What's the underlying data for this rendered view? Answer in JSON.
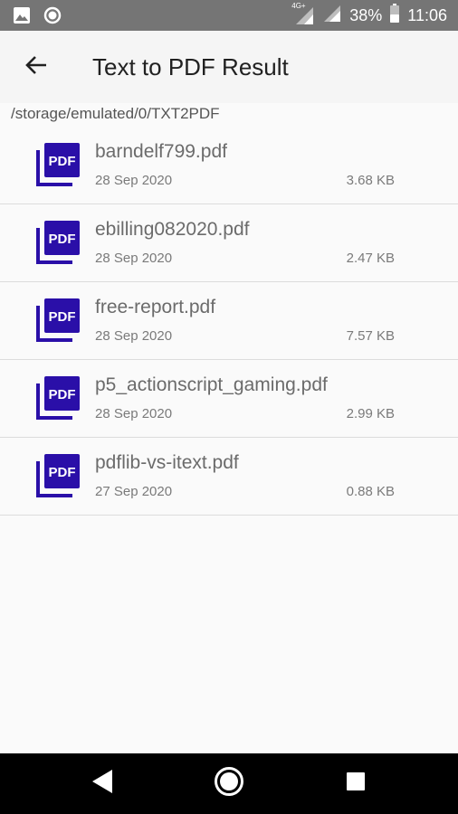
{
  "status_bar": {
    "network_label": "4G+",
    "battery_percent": "38%",
    "time": "11:06",
    "icons": [
      "image-icon",
      "record-icon",
      "signal-4g-icon",
      "signal-icon",
      "battery-icon"
    ]
  },
  "app_bar": {
    "title": "Text to PDF Result",
    "back_icon": "arrow-left-icon"
  },
  "path": "/storage/emulated/0/TXT2PDF",
  "files": [
    {
      "name": "barndelf799.pdf",
      "date": "28 Sep 2020",
      "size": "3.68 KB"
    },
    {
      "name": "ebilling082020.pdf",
      "date": "28 Sep 2020",
      "size": "2.47 KB"
    },
    {
      "name": "free-report.pdf",
      "date": "28 Sep 2020",
      "size": "7.57 KB"
    },
    {
      "name": "p5_actionscript_gaming.pdf",
      "date": "28 Sep 2020",
      "size": "2.99 KB"
    },
    {
      "name": "pdflib-vs-itext.pdf",
      "date": "27 Sep 2020",
      "size": "0.88 KB"
    }
  ],
  "pdf_icon_label": "PDF",
  "colors": {
    "status_bar": "#757575",
    "app_bar": "#f5f5f5",
    "pdf_icon": "#2a0fa8",
    "nav_bar": "#000000"
  },
  "nav_bar": {
    "icons": [
      "back-triangle-icon",
      "home-circle-icon",
      "recents-square-icon"
    ]
  }
}
